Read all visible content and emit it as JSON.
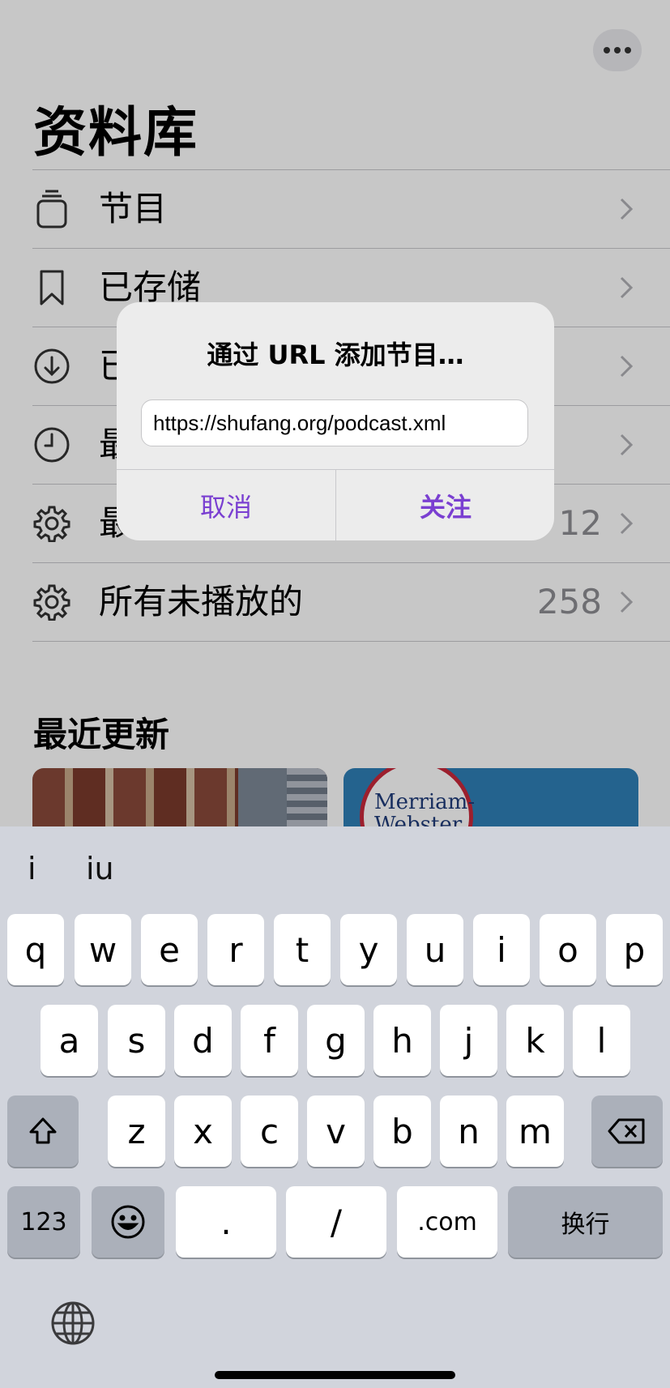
{
  "header": {
    "more_icon": "ellipsis-icon",
    "title": "资料库"
  },
  "library": {
    "items": [
      {
        "label": "节目",
        "icon": "stack-icon",
        "count": ""
      },
      {
        "label": "已存储",
        "icon": "bookmark-icon",
        "count": ""
      },
      {
        "label": "已",
        "icon": "download-icon",
        "count": ""
      },
      {
        "label": "最",
        "icon": "clock-icon",
        "count": ""
      },
      {
        "label": "最",
        "icon": "gear-icon",
        "count": "12"
      },
      {
        "label": "所有未播放的",
        "icon": "gear-icon",
        "count": "258"
      }
    ]
  },
  "recent": {
    "title": "最近更新",
    "cards": [
      {
        "name": "building-artwork"
      },
      {
        "name": "merriam-webster-artwork",
        "text_line1": "Merriam-",
        "text_line2": "Webster"
      }
    ]
  },
  "dialog": {
    "title": "通过 URL 添加节目…",
    "url_value": "https://shufang.org/podcast.xml",
    "cancel_label": "取消",
    "follow_label": "关注"
  },
  "keyboard": {
    "candidates": [
      "i",
      "iu"
    ],
    "row1": [
      "q",
      "w",
      "e",
      "r",
      "t",
      "y",
      "u",
      "i",
      "o",
      "p"
    ],
    "row2": [
      "a",
      "s",
      "d",
      "f",
      "g",
      "h",
      "j",
      "k",
      "l"
    ],
    "row3": [
      "z",
      "x",
      "c",
      "v",
      "b",
      "n",
      "m"
    ],
    "row4": {
      "numbers": "123",
      "dot": ".",
      "slash": "/",
      "dotcom": ".com",
      "return": "换行"
    },
    "icons": {
      "shift": "shift-icon",
      "delete": "delete-icon",
      "emoji": "emoji-icon",
      "globe": "globe-icon"
    }
  },
  "colors": {
    "accent": "#7a3fd1",
    "secondary_text": "#8e8e93",
    "keyboard_bg": "#d1d4dc"
  }
}
